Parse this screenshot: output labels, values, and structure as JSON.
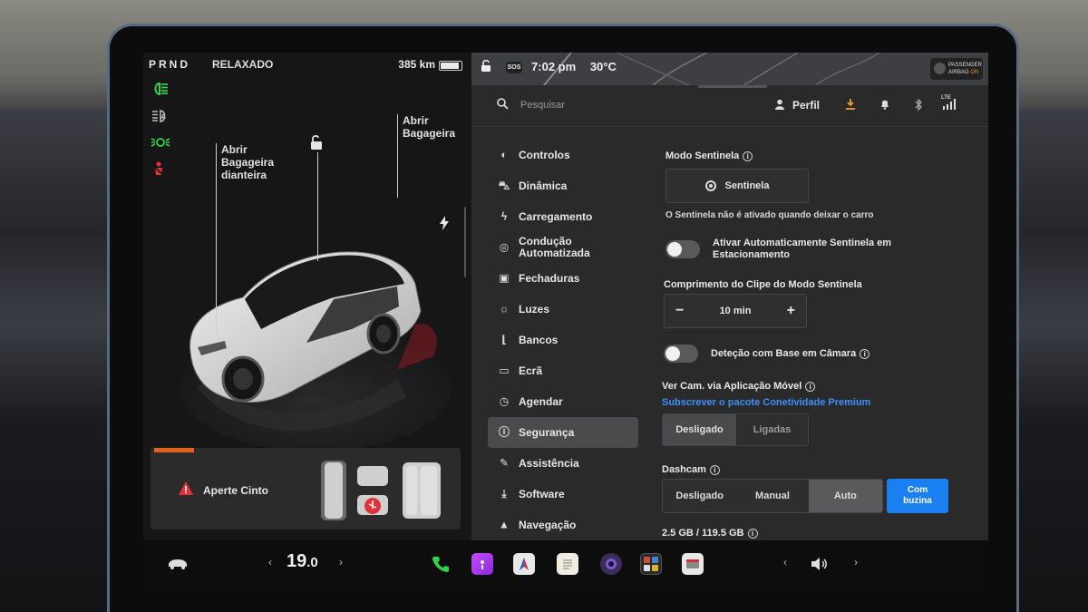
{
  "status": {
    "gear": "PRND",
    "drive_mode": "RELAXADO",
    "range": "385 km"
  },
  "car_labels": {
    "front_trunk": "Abrir\nBagageira\ndianteira",
    "front_trunk_l1": "Abrir",
    "front_trunk_l2": "Bagageira",
    "front_trunk_l3": "dianteira",
    "rear_trunk_l1": "Abrir",
    "rear_trunk_l2": "Bagageira"
  },
  "seatbelt": {
    "alert": "Aperte Cinto"
  },
  "topbar": {
    "time": "7:02 pm",
    "temperature": "30°C",
    "sos": "SOS",
    "airbag_l1": "PASSENGER",
    "airbag_l2": "AIRBAG",
    "airbag_state": "ON"
  },
  "header": {
    "search_placeholder": "Pesquisar",
    "profile": "Perfil",
    "lte": "LTE"
  },
  "menu": [
    {
      "label": "Controlos",
      "icon": "toggle-icon"
    },
    {
      "label": "Dinâmica",
      "icon": "car-icon"
    },
    {
      "label": "Carregamento",
      "icon": "bolt-icon"
    },
    {
      "label": "Condução Automatizada",
      "icon": "steering-wheel-icon"
    },
    {
      "label": "Fechaduras",
      "icon": "lock-icon"
    },
    {
      "label": "Luzes",
      "icon": "sun-icon"
    },
    {
      "label": "Bancos",
      "icon": "seat-icon"
    },
    {
      "label": "Ecrã",
      "icon": "screen-icon"
    },
    {
      "label": "Agendar",
      "icon": "clock-icon"
    },
    {
      "label": "Segurança",
      "icon": "info-icon"
    },
    {
      "label": "Assistência",
      "icon": "wrench-icon"
    },
    {
      "label": "Software",
      "icon": "download-icon"
    },
    {
      "label": "Navegação",
      "icon": "navigation-icon"
    }
  ],
  "active_menu": "Segurança",
  "security": {
    "sentry_title": "Modo Sentinela",
    "sentry_button": "Sentinela",
    "sentry_note": "O Sentinela não é ativado quando deixar o carro",
    "auto_sentry_l1": "Ativar Automaticamente Sentinela em",
    "auto_sentry_l2": "Estacionamento",
    "clip_title": "Comprimento do Clipe do Modo Sentinela",
    "clip_value": "10 min",
    "camera_detection": "Deteção com Base em Câmara",
    "view_cam_title": "Ver Cam. via Aplicação Móvel",
    "premium_link": "Subscrever o pacote Conetividade Premium",
    "view_cam_off": "Desligado",
    "view_cam_on": "Ligadas",
    "dashcam_title": "Dashcam",
    "dashcam_options": [
      "Desligado",
      "Manual",
      "Auto"
    ],
    "dashcam_horn_l1": "Com",
    "dashcam_horn_l2": "buzina",
    "storage": "2.5 GB / 119.5 GB"
  },
  "dock": {
    "temp_int": "19",
    "temp_dec": ".0"
  },
  "colors": {
    "accent_blue": "#1a7ff0",
    "link_blue": "#3b8fff",
    "warning_red": "#e0323a",
    "seatbelt_orange": "#e0621e",
    "light_green": "#31d14a"
  }
}
